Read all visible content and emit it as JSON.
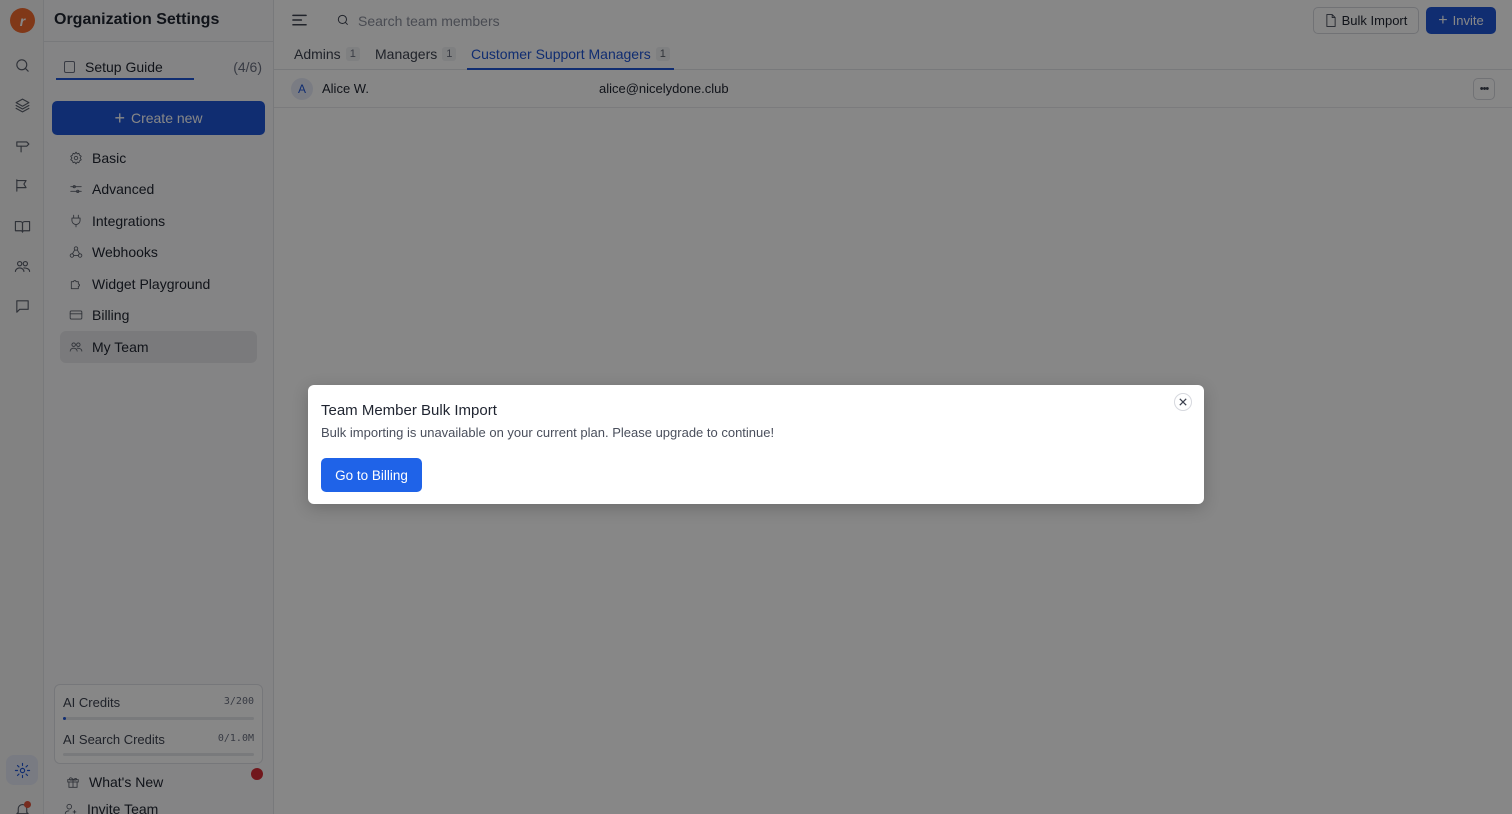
{
  "app": {
    "logo_letter": "r",
    "title": "Organization Settings"
  },
  "rail": {
    "icons": [
      "search-icon",
      "layers-icon",
      "signpost-icon",
      "tags-icon",
      "book-icon",
      "team-icon",
      "chat-icon",
      "settings-icon",
      "bell-icon"
    ]
  },
  "sidebar": {
    "setup_guide": {
      "label": "Setup Guide",
      "progress": "(4/6)",
      "completed": 4,
      "total": 6
    },
    "create_label": "Create new",
    "items": [
      {
        "label": "Basic",
        "icon": "gear-icon"
      },
      {
        "label": "Advanced",
        "icon": "sliders-icon"
      },
      {
        "label": "Integrations",
        "icon": "plug-icon"
      },
      {
        "label": "Webhooks",
        "icon": "webhook-icon"
      },
      {
        "label": "Widget Playground",
        "icon": "puzzle-icon"
      },
      {
        "label": "Billing",
        "icon": "credit-card-icon"
      },
      {
        "label": "My Team",
        "icon": "team-icon",
        "active": true
      }
    ],
    "credits": [
      {
        "label": "AI Credits",
        "value": "3/200",
        "fraction": 0.015
      },
      {
        "label": "AI Search Credits",
        "value": "0/1.0M",
        "fraction": 0
      }
    ],
    "whats_new": "What's New",
    "invite_team": "Invite Team"
  },
  "topbar": {
    "search_placeholder": "Search team members",
    "bulk_import_label": "Bulk Import",
    "invite_label": "Invite"
  },
  "tabs": [
    {
      "label": "Admins",
      "count": "1"
    },
    {
      "label": "Managers",
      "count": "1"
    },
    {
      "label": "Customer Support Managers",
      "count": "1",
      "active": true
    }
  ],
  "members": [
    {
      "initial": "A",
      "name": "Alice W.",
      "email": "alice@nicelydone.club"
    }
  ],
  "modal": {
    "title": "Team Member Bulk Import",
    "description": "Bulk importing is unavailable on your current plan. Please upgrade to continue!",
    "button_label": "Go to Billing"
  },
  "colors": {
    "accent": "#1f55d6",
    "brand": "#f26a2e",
    "notify": "#d62d35"
  }
}
